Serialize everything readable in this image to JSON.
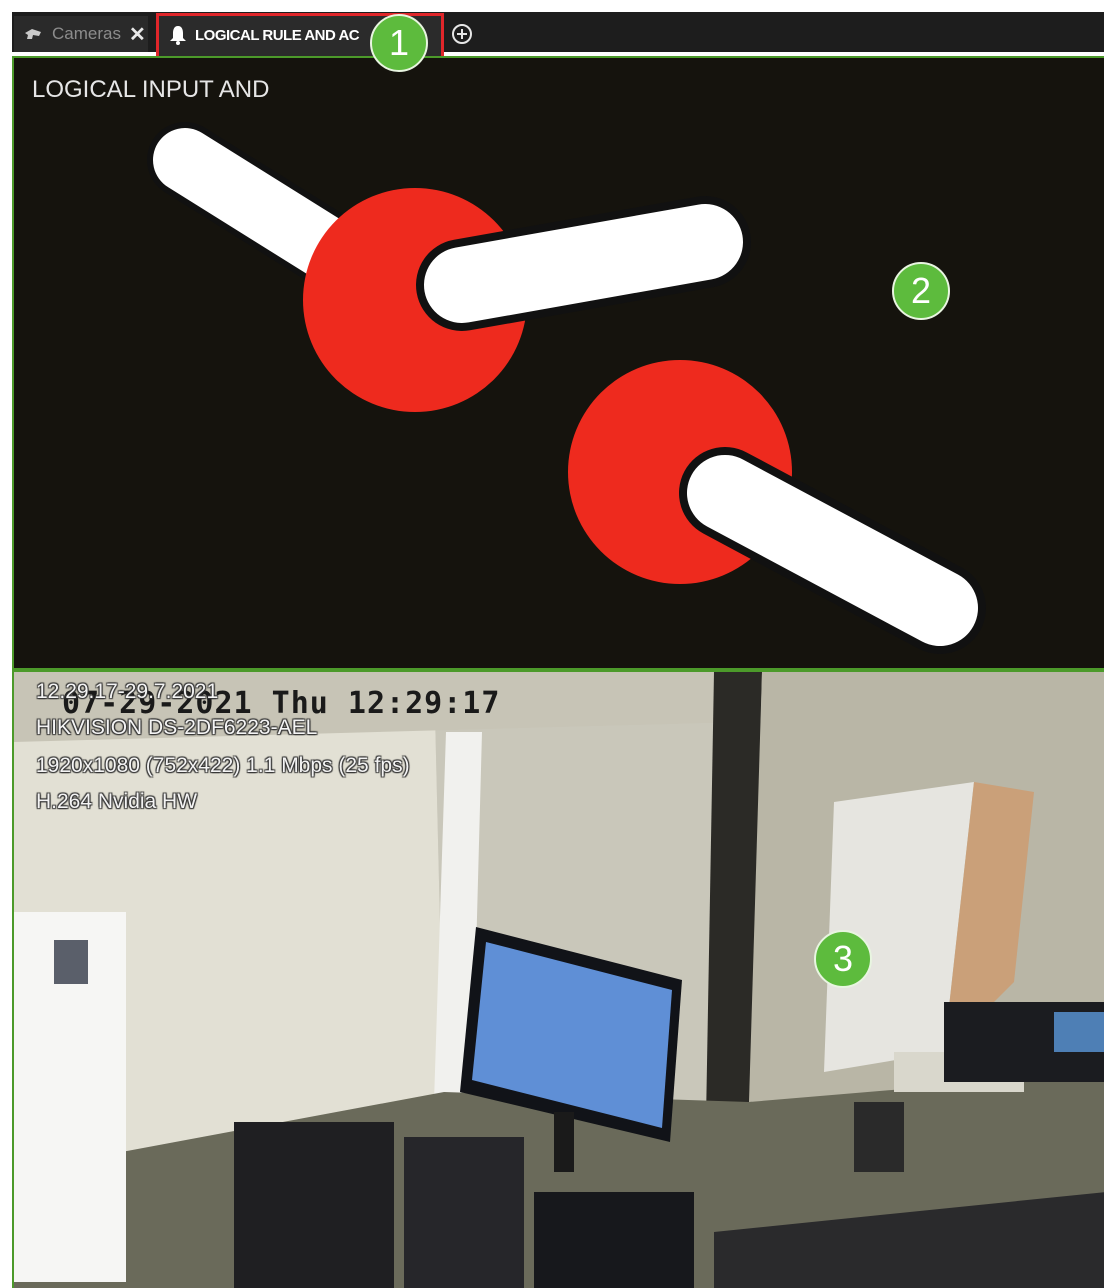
{
  "tabs": {
    "cameras_label": "Cameras",
    "close_glyph": "✕",
    "logical_label": "LOGICAL RULE AND AC",
    "add_icon": "plus-circle-icon"
  },
  "top_panel": {
    "title": "LOGICAL INPUT AND"
  },
  "camera": {
    "osd_date": "07-29-2021 Thu 12:29:17",
    "timestamp": "12.29.17-29.7.2021",
    "model": "HIKVISION DS-2DF6223-AEL",
    "stream": "1920x1080 (752x422) 1.1 Mbps (25 fps)",
    "codec": "H.264 Nvidia HW"
  },
  "markers": [
    "1",
    "2",
    "3"
  ],
  "colors": {
    "accent_green": "#4c9a2a",
    "highlight_red": "#e0262a",
    "toggle_red": "#ee2a1e",
    "marker_green": "#5dbb3d"
  }
}
